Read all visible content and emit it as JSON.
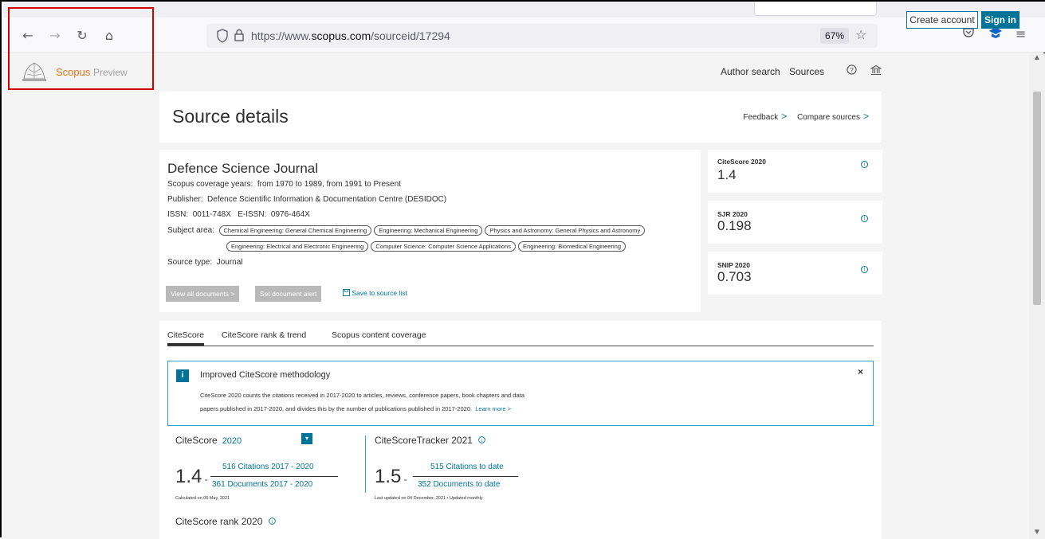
{
  "browser": {
    "url_prefix": "https://www.",
    "url_domain": "scopus.com",
    "url_path": "/sourceid/17294",
    "zoom": "67%"
  },
  "brand": {
    "name": "Scopus",
    "suffix": "Preview"
  },
  "header": {
    "author_search": "Author search",
    "sources": "Sources",
    "create_account": "Create account",
    "sign_in": "Sign in"
  },
  "page": {
    "title": "Source details",
    "feedback": "Feedback",
    "compare": "Compare sources"
  },
  "journal": {
    "name": "Defence Science Journal",
    "coverage_label": "Scopus coverage years:",
    "coverage_value": "from 1970 to 1989, from 1991 to Present",
    "publisher_label": "Publisher:",
    "publisher_value": "Defence Scientific Information & Documentation Centre (DESIDOC)",
    "issn_label": "ISSN:",
    "issn_value": "0011-748X",
    "eissn_label": "E-ISSN:",
    "eissn_value": "0976-464X",
    "subject_label": "Subject area:",
    "subjects_row1": [
      "Chemical Engineering: General Chemical Engineering",
      "Engineering: Mechanical Engineering",
      "Physics and Astronomy: General Physics and Astronomy"
    ],
    "subjects_row2": [
      "Engineering: Electrical and Electronic Engineering",
      "Computer Science: Computer Science Applications",
      "Engineering: Biomedical Engineering"
    ],
    "source_type_label": "Source type:",
    "source_type_value": "Journal",
    "view_all": "View all documents >",
    "set_alert": "Set document alert",
    "save_list": "Save to source list"
  },
  "metrics": [
    {
      "label": "CiteScore 2020",
      "value": "1.4"
    },
    {
      "label": "SJR 2020",
      "value": "0.198"
    },
    {
      "label": "SNIP 2020",
      "value": "0.703"
    }
  ],
  "tabs": [
    "CiteScore",
    "CiteScore rank & trend",
    "Scopus content coverage"
  ],
  "notice": {
    "icon": "i",
    "title": "Improved CiteScore methodology",
    "body1": "CiteScore 2020 counts the citations received in 2017-2020 to articles, reviews, conference papers, book chapters and data",
    "body2": "papers published in 2017-2020, and divides this by the number of publications published in 2017-2020.",
    "learn_more": "Learn more >"
  },
  "citescore": {
    "label": "CiteScore",
    "year": "2020",
    "value": "1.4",
    "citations": "516 Citations 2017 - 2020",
    "documents": "361 Documents 2017 - 2020",
    "calc": "Calculated on 05 May, 2021"
  },
  "tracker": {
    "label": "CiteScoreTracker 2021",
    "value": "1.5",
    "citations": "515 Citations to date",
    "documents": "352 Documents to date",
    "updated": "Last updated on 04 December, 2021 • Updated monthly"
  },
  "rank": {
    "label": "CiteScore rank 2020"
  }
}
